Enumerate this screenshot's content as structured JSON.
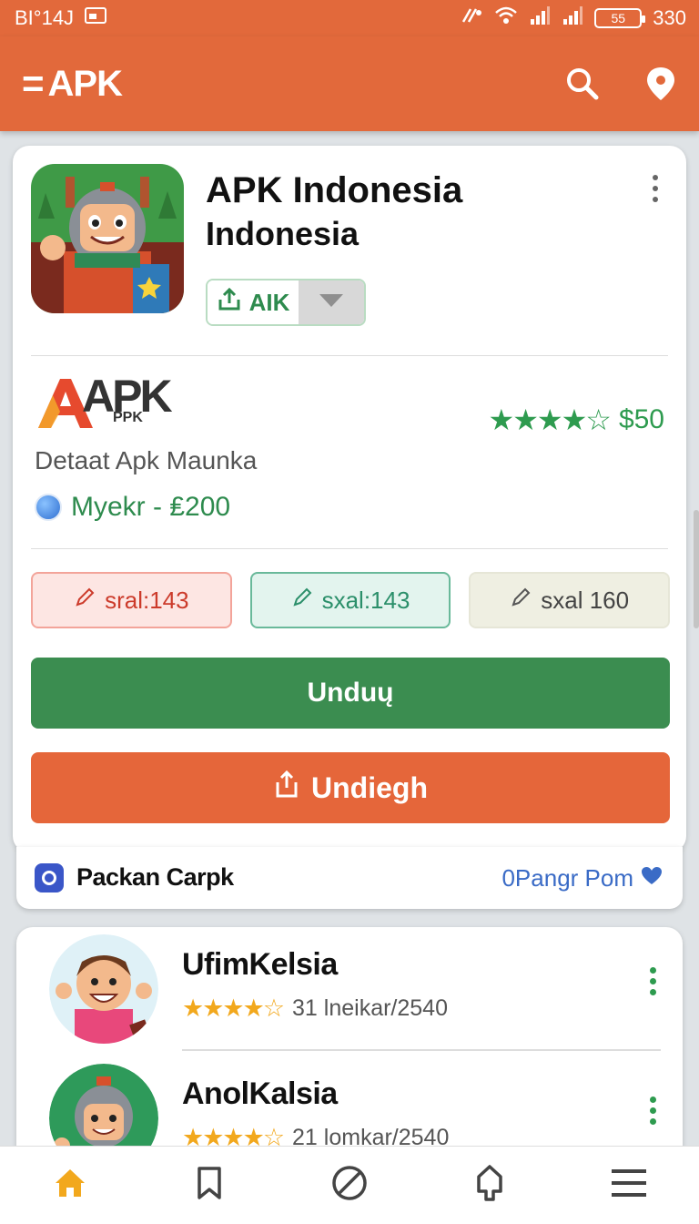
{
  "status_bar": {
    "left_text": "BI°14J",
    "battery": "55",
    "time": "330"
  },
  "app_bar": {
    "title": "APK",
    "menu_glyph": "="
  },
  "app": {
    "name": "APK Indonesia",
    "subtitle": "Indonesia",
    "install_label": "AIK"
  },
  "brand": {
    "logo_big": "APK",
    "logo_small": "PPK",
    "rating_stars": "★★★★☆",
    "rating_value": "$50",
    "description": "Detaat Apk Maunka",
    "price": "Myekr - ₤200"
  },
  "chips": [
    {
      "label": "sral:143"
    },
    {
      "label": "sxal:143"
    },
    {
      "label": "sxal 160"
    }
  ],
  "buttons": {
    "primary": "Unduų",
    "secondary": "Undiegh"
  },
  "package_bar": {
    "label": "Packan Carpk",
    "link": "0Pangr Pom"
  },
  "list": [
    {
      "title": "UfimKelsia",
      "stars": "★★★★☆",
      "meta": "31 lneikar/2540"
    },
    {
      "title": "AnolKalsia",
      "stars": "★★★★☆",
      "meta": "21 lomkar/2540"
    }
  ],
  "colors": {
    "accent": "#e2693b",
    "green": "#3b8d50",
    "orange": "#e5663a"
  },
  "icons": {
    "app_bar": [
      "search-icon",
      "location-pin-icon"
    ],
    "bottom_nav": [
      "home-icon",
      "bookmark-icon",
      "explore-icon",
      "tag-icon",
      "menu-icon"
    ]
  }
}
